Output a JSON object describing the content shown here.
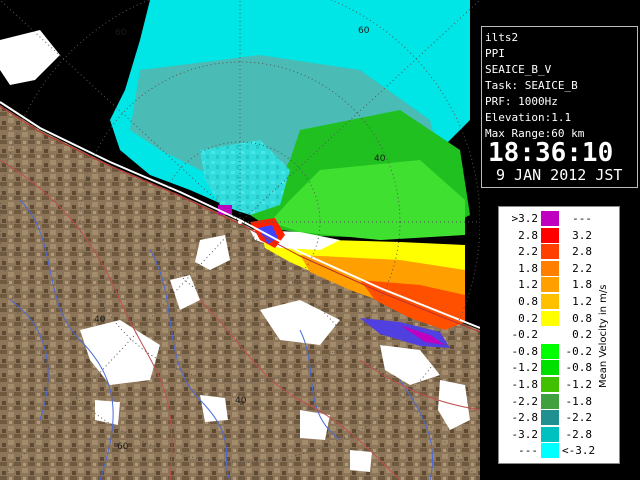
{
  "radar": {
    "range_labels": [
      "60",
      "60",
      "40",
      "40",
      "40",
      "60"
    ]
  },
  "info": {
    "site": "ilts2",
    "product": "PPI",
    "variable": "SEAICE_B_V",
    "task": "Task: SEAICE_B",
    "prf": "PRF: 1000Hz",
    "elevation": "Elevation:1.1",
    "max_range": "Max Range:60 km",
    "time": "18:36:10",
    "date": "9 JAN 2012 JST"
  },
  "legend": {
    "title": "Mean Velocity in m/s",
    "rows": [
      {
        "lo": ">3.2",
        "hi": "---",
        "color": "#c000c0"
      },
      {
        "lo": "2.8",
        "hi": "3.2",
        "color": "#ff0000"
      },
      {
        "lo": "2.2",
        "hi": "2.8",
        "color": "#ff4000"
      },
      {
        "lo": "1.8",
        "hi": "2.2",
        "color": "#ff8000"
      },
      {
        "lo": "1.2",
        "hi": "1.8",
        "color": "#ffa000"
      },
      {
        "lo": "0.8",
        "hi": "1.2",
        "color": "#ffc000"
      },
      {
        "lo": "0.2",
        "hi": "0.8",
        "color": "#ffff00"
      },
      {
        "lo": "-0.2",
        "hi": "0.2",
        "color": "#ffffff"
      },
      {
        "lo": "-0.8",
        "hi": "-0.2",
        "color": "#00ff00"
      },
      {
        "lo": "-1.2",
        "hi": "-0.8",
        "color": "#00e000"
      },
      {
        "lo": "-1.8",
        "hi": "-1.2",
        "color": "#40c000"
      },
      {
        "lo": "-2.2",
        "hi": "-1.8",
        "color": "#40a040"
      },
      {
        "lo": "-2.8",
        "hi": "-2.2",
        "color": "#209090"
      },
      {
        "lo": "-3.2",
        "hi": "-2.8",
        "color": "#00c0c0"
      },
      {
        "lo": "---",
        "hi": "<-3.2",
        "color": "#00ffff"
      }
    ]
  }
}
